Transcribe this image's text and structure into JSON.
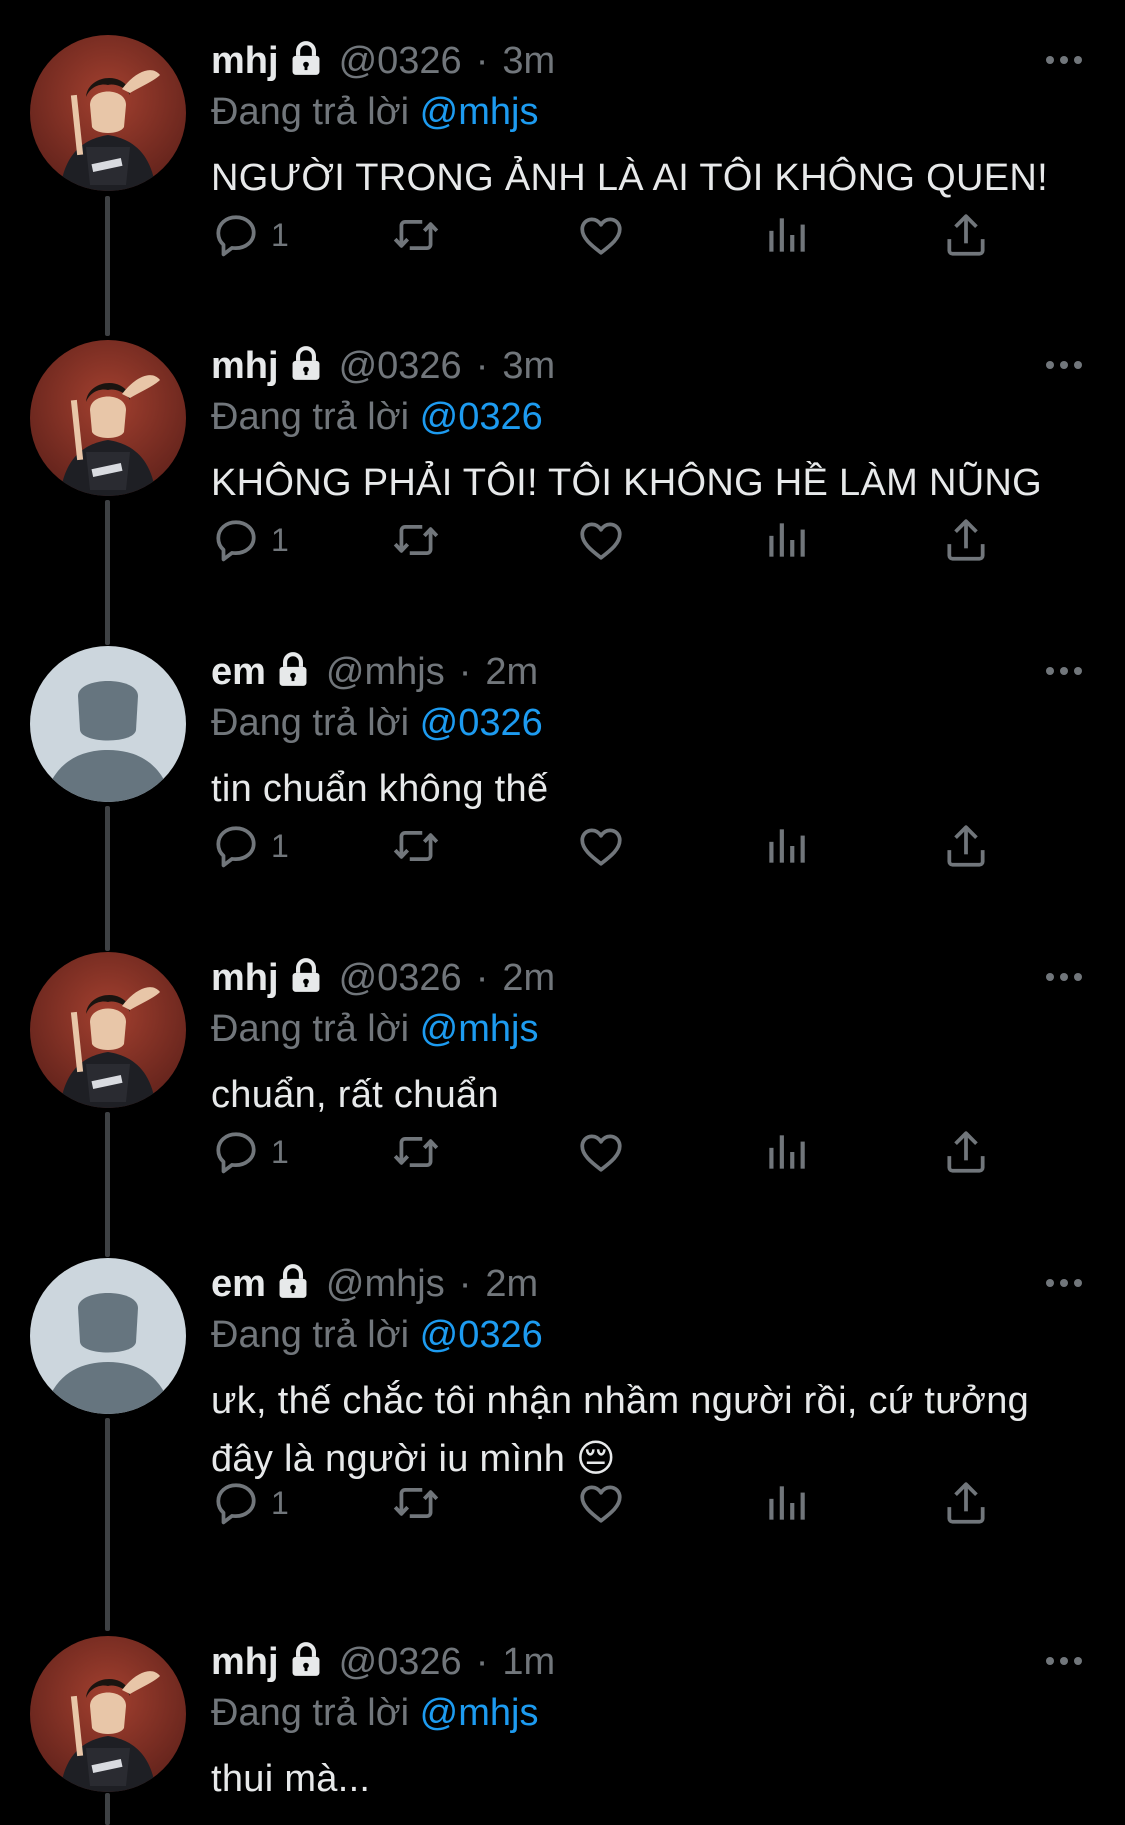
{
  "reply_prefix": "Đang trả lời",
  "colors": {
    "background": "#000000",
    "text": "#e7e9ea",
    "secondary": "#71767b",
    "accent": "#1d9bf0",
    "thread_line": "#3e4144"
  },
  "icons": {
    "reply": "reply-icon",
    "retweet": "retweet-icon",
    "like": "heart-icon",
    "views": "analytics-icon",
    "share": "share-icon",
    "more": "more-icon",
    "lock": "lock-icon"
  },
  "tweets": [
    {
      "avatar": "photo",
      "name": "mhj",
      "handle": "@0326",
      "time": "3m",
      "reply_to": "@mhjs",
      "text": "NGƯỜI TRONG ẢNH LÀ AI TÔI KHÔNG QUEN!",
      "reply_count": "1"
    },
    {
      "avatar": "photo",
      "name": "mhj",
      "handle": "@0326",
      "time": "3m",
      "reply_to": "@0326",
      "text": "KHÔNG PHẢI TÔI! TÔI KHÔNG HỀ LÀM NŨNG",
      "reply_count": "1"
    },
    {
      "avatar": "default",
      "name": "em",
      "handle": "@mhjs",
      "time": "2m",
      "reply_to": "@0326",
      "text": "tin chuẩn không thế",
      "reply_count": "1"
    },
    {
      "avatar": "photo",
      "name": "mhj",
      "handle": "@0326",
      "time": "2m",
      "reply_to": "@mhjs",
      "text": "chuẩn, rất chuẩn",
      "reply_count": "1"
    },
    {
      "avatar": "default",
      "name": "em",
      "handle": "@mhjs",
      "time": "2m",
      "reply_to": "@0326",
      "text": "ưk, thế chắc tôi nhận nhầm người rồi, cứ tưởng đây là người iu mình 😔",
      "reply_count": "1"
    },
    {
      "avatar": "photo",
      "name": "mhj",
      "handle": "@0326",
      "time": "1m",
      "reply_to": "@mhjs",
      "text": "thui mà...",
      "reply_count": ""
    }
  ]
}
